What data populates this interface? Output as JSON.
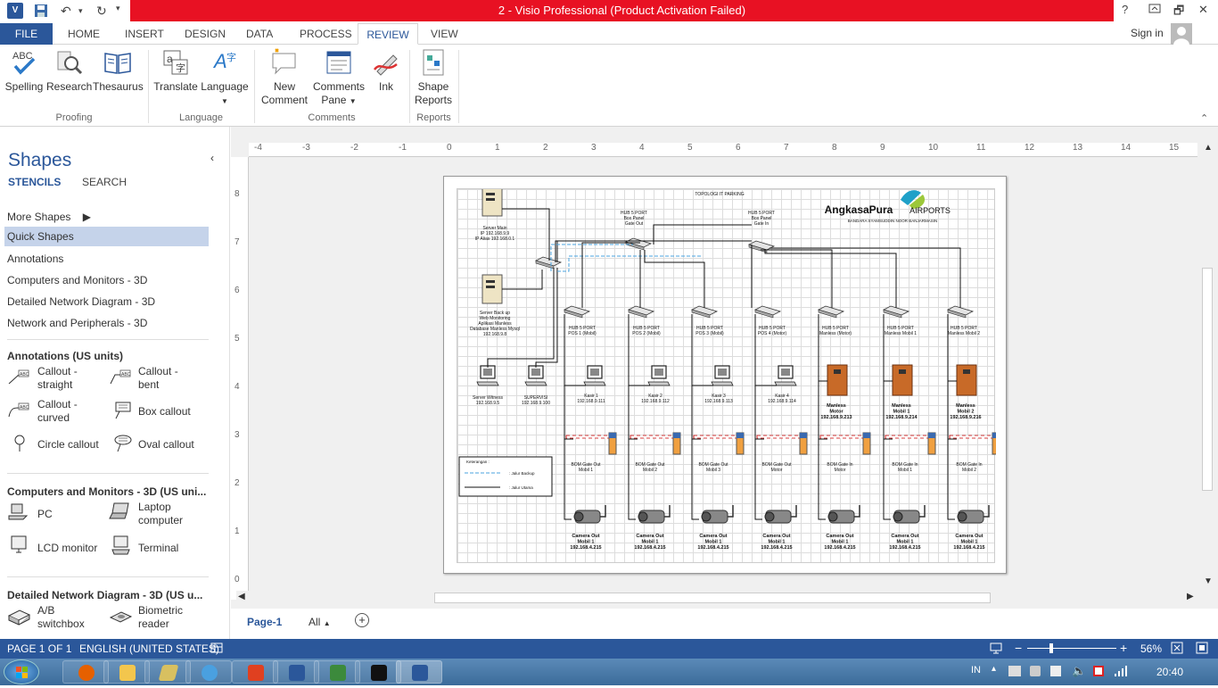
{
  "titlebar": {
    "title": "2 -  Visio Professional (Product Activation Failed)",
    "help": "?",
    "restore": "🗗",
    "minimize": "—",
    "close": "✕",
    "app_badge": "V"
  },
  "tabs": [
    "FILE",
    "HOME",
    "INSERT",
    "DESIGN",
    "DATA",
    "PROCESS",
    "REVIEW",
    "VIEW"
  ],
  "active_tab": "REVIEW",
  "account": {
    "signin": "Sign in"
  },
  "ribbon": {
    "spelling": "Spelling",
    "spelling_badge": "ABC",
    "research": "Research",
    "thesaurus": "Thesaurus",
    "translate": "Translate",
    "language": "Language",
    "new_comment": [
      "New",
      "Comment"
    ],
    "comments_pane": [
      "Comments",
      "Pane"
    ],
    "ink": "Ink",
    "shape_reports": [
      "Shape",
      "Reports"
    ],
    "groups": {
      "proofing": "Proofing",
      "language": "Language",
      "comments": "Comments",
      "reports": "Reports"
    }
  },
  "shapes_panel": {
    "title": "Shapes",
    "tab_stencils": "STENCILS",
    "tab_search": "SEARCH",
    "more_shapes": "More Shapes",
    "stencils": [
      "Quick Shapes",
      "Annotations",
      "Computers and Monitors - 3D",
      "Detailed Network Diagram - 3D",
      "Network and Peripherals - 3D"
    ],
    "annotations_head": "Annotations (US units)",
    "annotations": [
      "Callout - straight",
      "Callout - bent",
      "Callout - curved",
      "Box callout",
      "Circle callout",
      "Oval callout"
    ],
    "abc_badge": "ABC",
    "computers_head": "Computers and Monitors - 3D (US uni...",
    "computers": [
      "PC",
      "Laptop computer",
      "LCD monitor",
      "Terminal"
    ],
    "network_head": "Detailed Network Diagram - 3D (US u...",
    "network": [
      "A/B switchbox",
      "Biometric reader"
    ]
  },
  "ruler": {
    "h": [
      "-4",
      "-3",
      "-2",
      "-1",
      "0",
      "1",
      "2",
      "3",
      "4",
      "5",
      "6",
      "7",
      "8",
      "9",
      "10",
      "11",
      "12",
      "13",
      "14",
      "15"
    ],
    "v": [
      "8",
      "7",
      "6",
      "5",
      "4",
      "3",
      "2",
      "1",
      "0"
    ]
  },
  "diagram": {
    "title": "TOPOLOGI IT PARKING",
    "logo_left": "AngkasaPura",
    "logo_right": "AIRPORTS",
    "logo_sub": "BANDARA SYAMSUDDIN NOOR BANJARMASIN",
    "server_main": [
      "Server Main",
      "IP 192.168.9.9",
      "IP Alias 192.168.0.1"
    ],
    "server_backup": [
      "Server Back up",
      "Web Monitoring",
      "Aplikasi Manless",
      "Database Manless Mysql",
      "192.168.9.8"
    ],
    "server_witness": [
      "Server Witness",
      "192.168.9.5"
    ],
    "supervisi": [
      "SUPERVISI",
      "192.168.9.100"
    ],
    "hub_out": [
      "HUB 5 PORT",
      "Box Panel",
      "Gate Out"
    ],
    "hub_in": [
      "HUB 5 PORT",
      "Box Panel",
      "Gate In"
    ],
    "hubs": [
      [
        "HUB 5 PORT",
        "POS 1 (Mobil)"
      ],
      [
        "HUB 5 PORT",
        "POS 2 (Mobil)"
      ],
      [
        "HUB 5 PORT",
        "POS 3 (Mobil)"
      ],
      [
        "HUB 5 PORT",
        "POS 4 (Motor)"
      ],
      [
        "HUB 5 PORT",
        "Manless (Motor)"
      ],
      [
        "HUB 5 PORT",
        "Manless Mobil 1"
      ],
      [
        "HUB 5 PORT",
        "Manless Mobil 2"
      ]
    ],
    "kasirs": [
      [
        "Kasir 1",
        "192.168.9.111"
      ],
      [
        "Kasir 2",
        "192.168.9.112"
      ],
      [
        "Kasir 3",
        "192.168.9.113"
      ],
      [
        "Kasir 4",
        "192.168.9.114"
      ]
    ],
    "manless": [
      [
        "Manless",
        "Motor",
        "192.168.9.213"
      ],
      [
        "Manless",
        "Mobil 1",
        "192.168.9.214"
      ],
      [
        "Manless",
        "Mobil 2",
        "192.168.9.216"
      ]
    ],
    "boms": [
      [
        "BOM Gate Out",
        "Mobil 1"
      ],
      [
        "BOM Gate Out",
        "Mobil 2"
      ],
      [
        "BOM Gate Out",
        "Mobil 3"
      ],
      [
        "BOM Gate Out",
        "Motor"
      ],
      [
        "BOM Gate In",
        "Motor"
      ],
      [
        "BOM Gate In",
        "Mobil 1"
      ],
      [
        "BOM Gate In",
        "Mobil 2"
      ]
    ],
    "cameras": [
      [
        "Camera Out",
        "Mobil 1",
        "192.168.4.215"
      ],
      [
        "Camera Out",
        "Mobil 1",
        "192.168.4.215"
      ],
      [
        "Camera Out",
        "Mobil 1",
        "192.168.4.215"
      ],
      [
        "Camera Out",
        "Mobil 1",
        "192.168.4.215"
      ],
      [
        "Camera Out",
        "Mobil 1",
        "192.168.4.215"
      ],
      [
        "Camera Out",
        "Mobil 1",
        "192.168.4.215"
      ],
      [
        "Camera Out",
        "Mobil 1",
        "192.168.4.215"
      ]
    ],
    "legend": {
      "title": "Keterangan :",
      "backup": ": Jalur Backup",
      "main": ": Jalur Utama"
    }
  },
  "pagetabs": {
    "page1": "Page-1",
    "all": "All",
    "add": "+"
  },
  "status": {
    "page": "PAGE 1 OF 1",
    "language": "ENGLISH (UNITED STATES)",
    "zoom": "56%",
    "zoom_level": 0.56,
    "minus": "−",
    "plus": "+"
  },
  "taskbar": {
    "lang": "IN",
    "time": "20:40"
  },
  "colors": {
    "accent": "#2b579a",
    "title_red": "#e81123",
    "quick_shapes_sel": "#c5d3ea",
    "backup_line": "#4aa3df"
  }
}
